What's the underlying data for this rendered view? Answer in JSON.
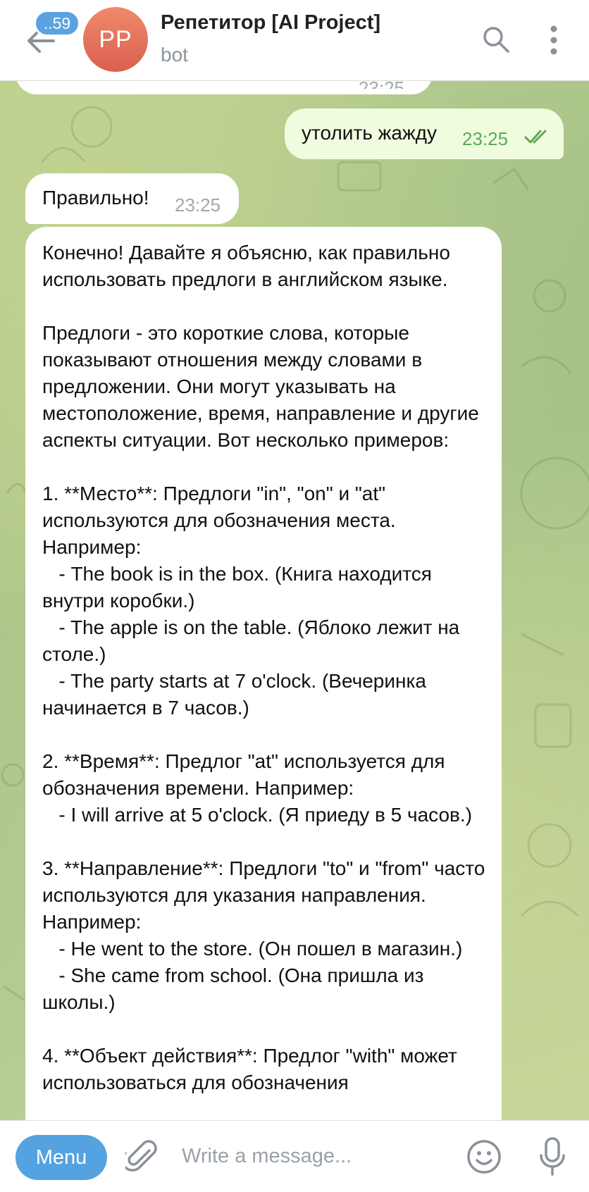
{
  "header": {
    "unread_count": "..59",
    "avatar_initials": "PP",
    "title": "Репетитор [AI Project]",
    "subtitle": "bot"
  },
  "messages": {
    "previous_time": "23:25",
    "outgoing": {
      "text": "утолить жажду",
      "time": "23:25"
    },
    "incoming_1": {
      "text": "Правильно!",
      "time": "23:25"
    },
    "incoming_2": {
      "text": "Конечно! Давайте я объясню, как правильно использовать предлоги в английском языке.\n\nПредлоги - это короткие слова, которые показывают отношения между словами в предложении. Они могут указывать на местоположение, время, направление и другие аспекты ситуации. Вот несколько примеров:\n\n1. **Место**: Предлоги \"in\", \"on\" и \"at\" используются для обозначения места. Например:\n   - The book is in the box. (Книга находится внутри коробки.)\n   - The apple is on the table. (Яблоко лежит на столе.)\n   - The party starts at 7 o'clock. (Вечеринка начинается в 7 часов.)\n\n2. **Время**: Предлог \"at\" используется для обозначения времени. Например:\n   - I will arrive at 5 o'clock. (Я приеду в 5 часов.)\n\n3. **Направление**: Предлоги \"to\" и \"from\" часто используются для указания направления. Например:\n   - He went to the store. (Он пошел в магазин.)\n   - She came from school. (Она пришла из школы.)\n\n4. **Объект действия**: Предлог \"with\" может использоваться для обозначения"
    }
  },
  "composer": {
    "menu_label": "Menu",
    "placeholder": "Write a message..."
  },
  "colors": {
    "accent": "#54a3e0",
    "outgoing_bubble": "#effdde",
    "outgoing_time": "#5fa85a",
    "avatar": "#e0705a"
  },
  "icons": [
    "back-arrow-icon",
    "search-icon",
    "more-vertical-icon",
    "double-check-icon",
    "attach-paperclip-icon",
    "emoji-icon",
    "microphone-icon"
  ]
}
